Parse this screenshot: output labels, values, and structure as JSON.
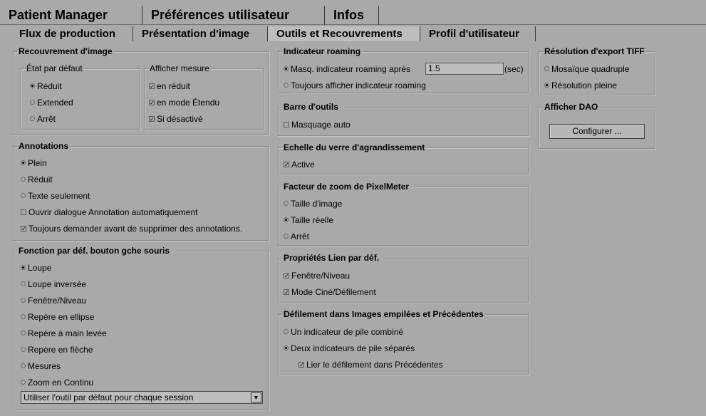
{
  "tabs_top": [
    "Patient Manager",
    "Préférences utilisateur",
    "Infos"
  ],
  "tabs_sub": [
    "Flux de production",
    "Présentation d'image",
    "Outils et Recouvrements",
    "Profil d'utilisateur"
  ],
  "active_tab_top": "Préférences utilisateur",
  "active_tab_sub": "Outils et Recouvrements",
  "image_overlay": {
    "title": "Recouvrement d'image",
    "default_state": {
      "title": "État par défaut",
      "options": [
        {
          "label": "Réduit",
          "selected": true
        },
        {
          "label": "Extended",
          "selected": false
        },
        {
          "label": "Arrêt",
          "selected": false
        }
      ]
    },
    "show_measure": {
      "title": "Afficher mesure",
      "options": [
        {
          "label": "en réduit",
          "checked": true
        },
        {
          "label": "en mode Étendu",
          "checked": true
        },
        {
          "label": "Si désactivé",
          "checked": true
        }
      ]
    }
  },
  "annotations": {
    "title": "Annotations",
    "radios": [
      {
        "label": "Plein",
        "selected": true
      },
      {
        "label": "Réduit",
        "selected": false
      },
      {
        "label": "Texte seulement",
        "selected": false
      }
    ],
    "checks": [
      {
        "label": "Ouvrir dialogue Annotation automatiquement",
        "checked": false
      },
      {
        "label": "Toujours demander avant de supprimer des annotations.",
        "checked": true
      }
    ]
  },
  "left_button": {
    "title": "Fonction par déf. bouton gche souris",
    "options": [
      {
        "label": "Loupe",
        "selected": true
      },
      {
        "label": "Loupe inversée",
        "selected": false
      },
      {
        "label": "Fenêtre/Niveau",
        "selected": false
      },
      {
        "label": "Repère en ellipse",
        "selected": false
      },
      {
        "label": "Repère à main levée",
        "selected": false
      },
      {
        "label": "Repère en flèche",
        "selected": false
      },
      {
        "label": "Mesures",
        "selected": false
      },
      {
        "label": "Zoom en Continu",
        "selected": false
      }
    ],
    "dropdown_value": "Utiliser l'outil par défaut pour chaque session"
  },
  "roaming": {
    "title": "Indicateur roaming",
    "hide_label": "Masq. indicateur roaming après",
    "hide_selected": true,
    "hide_value": "1.5",
    "unit": "(sec)",
    "always_label": "Toujours afficher indicateur roaming",
    "always_selected": false
  },
  "toolbar": {
    "title": "Barre d'outils",
    "auto_hide": "Masquage auto",
    "auto_hide_checked": false
  },
  "magnifier": {
    "title": "Echelle du verre d'agrandissement",
    "active": "Active",
    "active_checked": true
  },
  "pixelmeter": {
    "title": "Facteur de zoom de PixelMeter",
    "options": [
      {
        "label": "Taille d'image",
        "selected": false
      },
      {
        "label": "Taille réelle",
        "selected": true
      },
      {
        "label": "Arrêt",
        "selected": false
      }
    ]
  },
  "link_props": {
    "title": "Propriétés Lien par déf.",
    "options": [
      {
        "label": "Fenêtre/Niveau",
        "checked": true
      },
      {
        "label": "Mode Ciné/Défilement",
        "checked": true
      }
    ]
  },
  "stack_scroll": {
    "title": "Défilement dans Images empilées et Précédentes",
    "radios": [
      {
        "label": "Un indicateur de pile combiné",
        "selected": false
      },
      {
        "label": "Deux indicateurs de pile séparés",
        "selected": true
      }
    ],
    "link_label": "Lier le défilement dans Précédentes",
    "link_checked": true
  },
  "tiff": {
    "title": "Résolution d'export TIFF",
    "options": [
      {
        "label": "Mosaïque quadruple",
        "selected": false
      },
      {
        "label": "Résolution pleine",
        "selected": true
      }
    ]
  },
  "dao": {
    "title": "Afficher DAO",
    "button": "Configurer ..."
  }
}
